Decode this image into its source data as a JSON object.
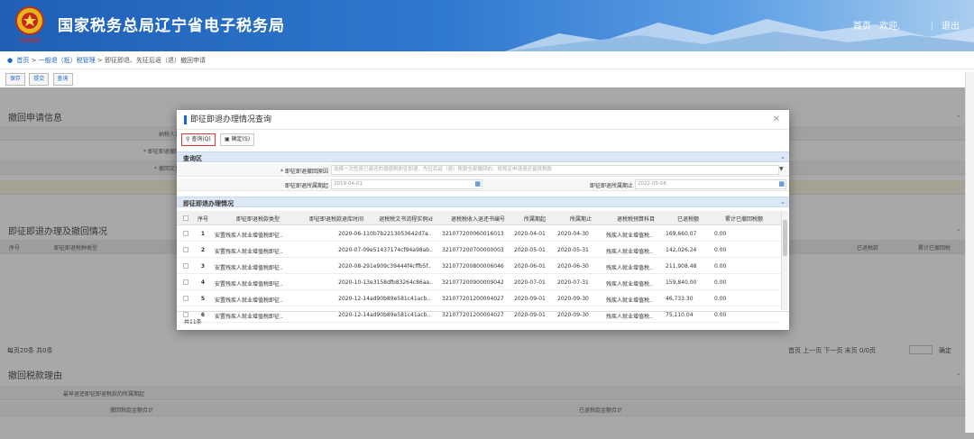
{
  "header": {
    "title": "国家税务总局辽宁省电子税务局",
    "links": [
      "首页",
      "欢迎,",
      "退出"
    ],
    "seal_text": "中国税务"
  },
  "breadcrumb": {
    "home": "首页",
    "items": [
      "一般退（抵）税管理",
      "即征即退、先征后返（退）撤回申请"
    ]
  },
  "toolbar": {
    "buttons": [
      "保存",
      "提交",
      "查询"
    ]
  },
  "main": {
    "sec1": "撤回申请信息",
    "fields": [
      "纳税人识",
      "* 即征即退撤回",
      "* 撤回文件"
    ],
    "sec2": "即征即退办理及撤回情况",
    "cols_left": [
      "序号",
      "即征即退税种类型"
    ],
    "cols_right": [
      "已退税款",
      "累计已撤回税"
    ],
    "pager_left": "每页20条 共0条",
    "pager_right": "首页 上一页 下一页 末页 0/0页",
    "pager_confirm": "确定",
    "sec3": "撤回税款理由",
    "f3a": "最早退还即征即退税款的所属期起",
    "f3b": "撤回税款金额合计",
    "f3c": "已退税款金额合计"
  },
  "dialog": {
    "title": "即征即退办理情况查询",
    "btn_query": "查询(Q)",
    "btn_ok": "确定(S)",
    "query_section": "查询区",
    "q1_label": "* 即征即退撤回原因",
    "q1_placeholder": "选择一次性将已退还的增值税即征即退、先征后返（退）税款全部撤回的，按规定申请退还留抵税款",
    "q2_label": "即征即退所属期起",
    "q2_value": "2019-04-01",
    "q3_label": "即征即退所属期止",
    "q3_value": "2022-05-06",
    "result_section": "即征即退办理情况",
    "columns": [
      "序号",
      "即征即退税款类型",
      "即征即退税款退库时间",
      "退税税文书流程实例id",
      "退税税收入退还书编号",
      "所属期起",
      "所属期止",
      "退税税预算科目",
      "已退税额",
      "累计已撤回税额"
    ],
    "rows": [
      [
        "1",
        "安置残疾人就业增值税即征..",
        "2020-06-11",
        "0b7b2213053642d7a..",
        "321077200060016013",
        "2020-04-01",
        "2020-04-30",
        "残疾人就业增值税..",
        "169,660.07",
        "0.00"
      ],
      [
        "2",
        "安置残疾人就业增值税即征..",
        "2020-07-09",
        "e51437174cf94a98ab..",
        "321077200700000003",
        "2020-05-01",
        "2020-05-31",
        "残疾人就业增值税..",
        "142,026.24",
        "0.00"
      ],
      [
        "3",
        "安置残疾人就业增值税即征..",
        "2020-08-29",
        "1e909c39444f4cffb5f..",
        "321077200800006046",
        "2020-06-01",
        "2020-06-30",
        "残疾人就业增值税..",
        "211,908.48",
        "0.00"
      ],
      [
        "4",
        "安置残疾人就业增值税即征..",
        "2020-10-13",
        "e3158dfb83264c86aa..",
        "321077200900009042",
        "2020-07-01",
        "2020-07-31",
        "残疾人就业增值税..",
        "159,840.00",
        "0.00"
      ],
      [
        "5",
        "安置残疾人就业增值税即征..",
        "2020-12-14",
        "ad90b89e581c41acb..",
        "321077201200004027",
        "2020-09-01",
        "2020-09-30",
        "残疾人就业增值税..",
        "46,733.30",
        "0.00"
      ],
      [
        "6",
        "安置残疾人就业增值税即征..",
        "2020-12-14",
        "ad90b89e581c41acb..",
        "321077201200004027",
        "2020-09-01",
        "2020-09-30",
        "残疾人就业增值税..",
        "75,110.04",
        "0.00"
      ]
    ],
    "total": "共11条"
  }
}
